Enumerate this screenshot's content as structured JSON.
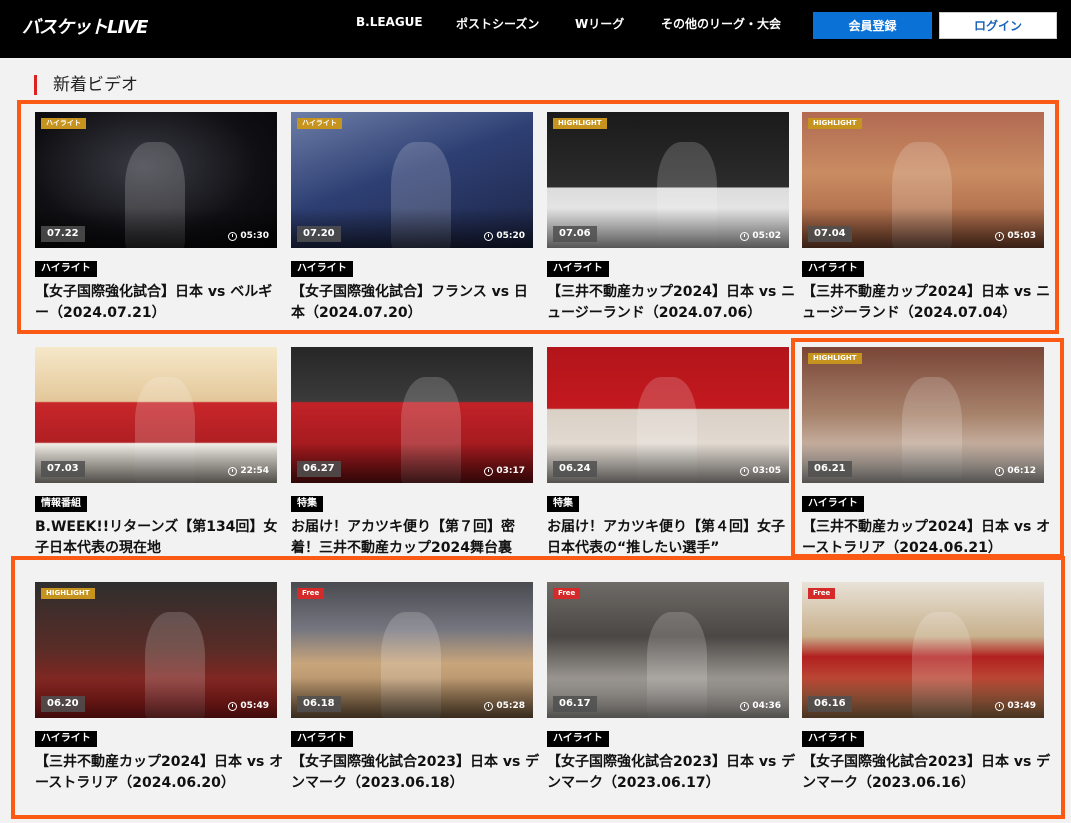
{
  "header": {
    "logo": "バスケットLIVE",
    "nav": [
      "B.LEAGUE",
      "ポストシーズン",
      "Wリーグ",
      "その他のリーグ・大会"
    ],
    "register_label": "会員登録",
    "login_label": "ログイン"
  },
  "section": {
    "title": "新着ビデオ"
  },
  "videos": [
    {
      "date": "07.22",
      "duration": "05:30",
      "category": "ハイライト",
      "title": "【女子国際強化試合】日本 vs ベルギー（2024.07.21）",
      "corner": "ハイライト"
    },
    {
      "date": "07.20",
      "duration": "05:20",
      "category": "ハイライト",
      "title": "【女子国際強化試合】フランス vs 日本（2024.07.20）",
      "corner": "ハイライト"
    },
    {
      "date": "07.06",
      "duration": "05:02",
      "category": "ハイライト",
      "title": "【三井不動産カップ2024】日本 vs ニュージーランド（2024.07.06）",
      "corner": "HIGHLIGHT"
    },
    {
      "date": "07.04",
      "duration": "05:03",
      "category": "ハイライト",
      "title": "【三井不動産カップ2024】日本 vs ニュージーランド（2024.07.04）",
      "corner": "HIGHLIGHT"
    },
    {
      "date": "07.03",
      "duration": "22:54",
      "category": "情報番組",
      "title": "B.WEEK!!リターンズ【第134回】女子日本代表の現在地",
      "corner": ""
    },
    {
      "date": "06.27",
      "duration": "03:17",
      "category": "特集",
      "title": "お届け！アカツキ便り【第７回】密着！三井不動産カップ2024舞台裏",
      "corner": ""
    },
    {
      "date": "06.24",
      "duration": "03:05",
      "category": "特集",
      "title": "お届け！アカツキ便り【第４回】女子日本代表の“推したい選手”",
      "corner": ""
    },
    {
      "date": "06.21",
      "duration": "06:12",
      "category": "ハイライト",
      "title": "【三井不動産カップ2024】日本 vs オーストラリア（2024.06.21）",
      "corner": "HIGHLIGHT"
    },
    {
      "date": "06.20",
      "duration": "05:49",
      "category": "ハイライト",
      "title": "【三井不動産カップ2024】日本 vs オーストラリア（2024.06.20）",
      "corner": "HIGHLIGHT"
    },
    {
      "date": "06.18",
      "duration": "05:28",
      "category": "ハイライト",
      "title": "【女子国際強化試合2023】日本 vs デンマーク（2023.06.18）",
      "corner": "Free"
    },
    {
      "date": "06.17",
      "duration": "04:36",
      "category": "ハイライト",
      "title": "【女子国際強化試合2023】日本 vs デンマーク（2023.06.17）",
      "corner": "Free"
    },
    {
      "date": "06.16",
      "duration": "03:49",
      "category": "ハイライト",
      "title": "【女子国際強化試合2023】日本 vs デンマーク（2023.06.16）",
      "corner": "Free"
    }
  ],
  "colors": {
    "accent_highlight_box": "#fa5a14",
    "register_button": "#0a72d6",
    "section_marker": "#dd2222"
  }
}
